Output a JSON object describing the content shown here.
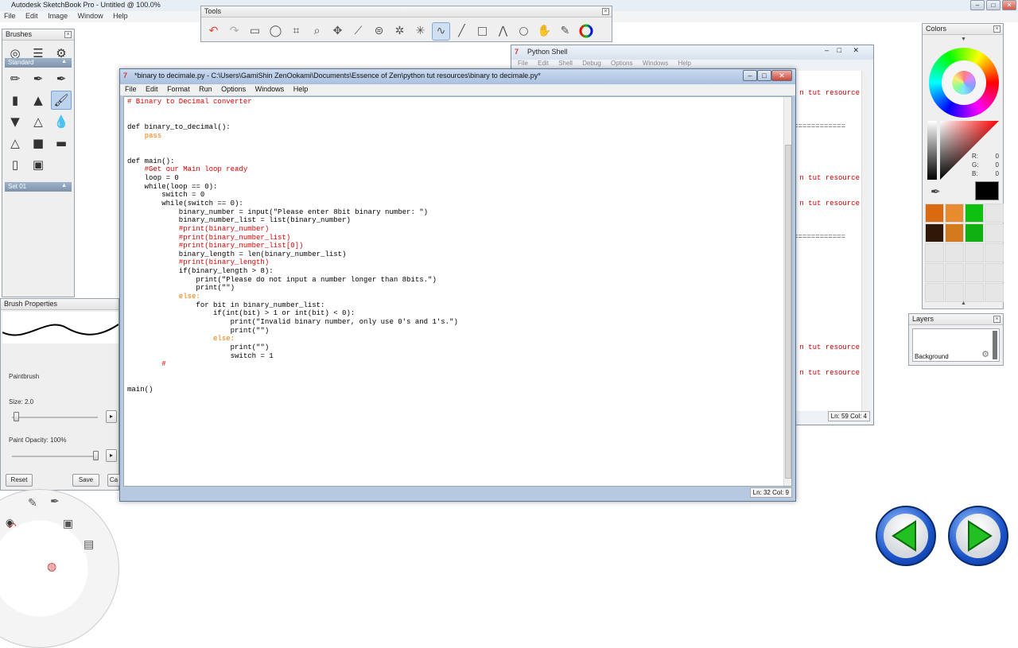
{
  "app": {
    "title": "Autodesk SketchBook Pro - Untitled @ 100.0%",
    "menu": [
      "File",
      "Edit",
      "Image",
      "Window",
      "Help"
    ]
  },
  "tools_panel": {
    "title": "Tools"
  },
  "brushes_panel": {
    "title": "Brushes",
    "set_standard": "Standard",
    "set_other": "Set 01"
  },
  "brush_properties": {
    "title": "Brush Properties",
    "brush_name": "Paintbrush",
    "size_label": "Size: 2.0",
    "opacity_label": "Paint Opacity: 100%",
    "reset_label": "Reset",
    "save_label": "Save",
    "cancel_label": "Ca",
    "size_fraction": 0.05,
    "opacity_fraction": 1.0
  },
  "colors_panel": {
    "title": "Colors",
    "r_label": "R:",
    "r_value": "0",
    "g_label": "G:",
    "g_value": "0",
    "b_label": "B:",
    "b_value": "0",
    "current_color": "#000000",
    "swatches": [
      "#d96a10",
      "#e88b2e",
      "#10c010",
      "#e6e6e6",
      "#301808",
      "#d47a1e",
      "#10b010",
      "#e6e6e6"
    ]
  },
  "layers_panel": {
    "title": "Layers",
    "layer_name": "Background"
  },
  "shell": {
    "title": "Python Shell",
    "menu": [
      "File",
      "Edit",
      "Shell",
      "Debug",
      "Options",
      "Windows",
      "Help"
    ],
    "fragment_1": "n tut resource",
    "fragment_2": "n tut resource",
    "fragment_3": "n tut resource",
    "fragment_4": "n tut resource",
    "fragment_5": "n tut resource",
    "separator": "==============",
    "status": "Ln: 59  Col: 4"
  },
  "editor": {
    "title": "*binary to decimale.py - C:\\Users\\GamiShin ZenOokami\\Documents\\Essence of Zen\\python tut resources\\binary to decimale.py*",
    "menu": [
      "File",
      "Edit",
      "Format",
      "Run",
      "Options",
      "Windows",
      "Help"
    ],
    "status": "Ln: 32  Col: 9",
    "code": {
      "l1": "# Binary to Decimal converter",
      "l4": "def binary_to_decimal():",
      "l5": "    pass",
      "l8": "def main():",
      "l9": "    #Get our Main loop ready",
      "l10": "    loop = 0",
      "l11": "    while(loop == 0):",
      "l12": "        switch = 0",
      "l13": "        while(switch == 0):",
      "l14": "            binary_number = input(\"Please enter 8bit binary number: \")",
      "l15": "            binary_number_list = list(binary_number)",
      "l16": "            #print(binary_number)",
      "l17": "            #print(binary_number_list)",
      "l18": "            #print(binary_number_list[0])",
      "l19": "            binary_length = len(binary_number_list)",
      "l20": "            #print(binary_length)",
      "l21": "            if(binary_length > 8):",
      "l22": "                print(\"Please do not input a number longer than 8bits.\")",
      "l23": "                print(\"\")",
      "l24": "            else:",
      "l25": "                for bit in binary_number_list:",
      "l26": "                    if(int(bit) > 1 or int(bit) < 0):",
      "l27": "                        print(\"Invalid binary number, only use 0's and 1's.\")",
      "l28": "                        print(\"\")",
      "l29": "                    else:",
      "l30": "                        print(\"\")",
      "l31": "                        switch = 1",
      "l32": "        #",
      "l35": "main()"
    }
  }
}
